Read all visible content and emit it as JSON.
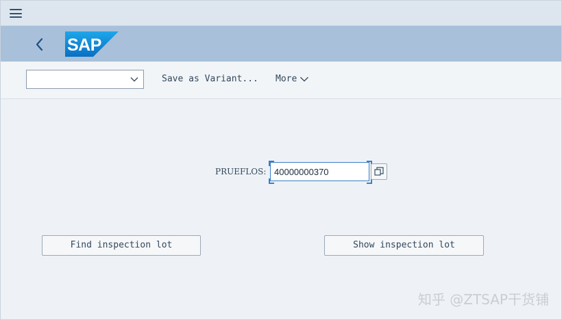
{
  "app": {
    "brand": "SAP"
  },
  "menubar": {
    "menu_icon": "hamburger-menu-icon"
  },
  "shellbar": {
    "back_icon": "chevron-left-icon",
    "logo_icon": "sap-logo",
    "background_color": "#a8c0d9"
  },
  "toolbar": {
    "variant_select_value": "",
    "variant_select_icon": "chevron-down-icon",
    "save_variant_label": "Save as Variant...",
    "more_label": "More",
    "more_icon": "chevron-down-icon"
  },
  "selection": {
    "field_label": "PRUEFLOS:",
    "field_value": "40000000370",
    "value_help_icon": "value-help-icon"
  },
  "actions": {
    "find_label": "Find inspection lot",
    "show_label": "Show inspection lot"
  },
  "watermark": {
    "text": "知乎 @ZTSAP干货铺"
  },
  "colors": {
    "focus_border": "#3b7ec7",
    "text": "#32475c"
  }
}
